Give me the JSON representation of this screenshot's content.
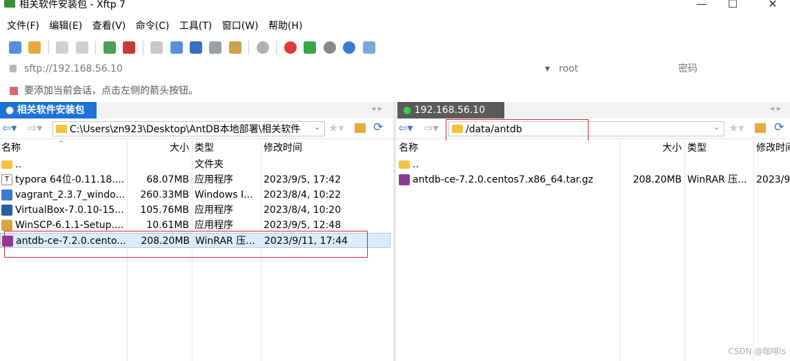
{
  "window": {
    "title": "相关软件安装包 - Xftp 7",
    "minimize": "—",
    "maximize": "☐",
    "close": "✕"
  },
  "menu": [
    "文件(F)",
    "编辑(E)",
    "查看(V)",
    "命令(C)",
    "工具(T)",
    "窗口(W)",
    "帮助(H)"
  ],
  "address": {
    "host": "sftp://192.168.56.10",
    "user": "root",
    "password": "密码"
  },
  "hint": "要添加当前会话，点击左侧的箭头按钮。",
  "left": {
    "tab": "相关软件安装包",
    "path": "C:\\Users\\zn923\\Desktop\\AntDB本地部署\\相关软件",
    "columns": {
      "name": "名称",
      "size": "大小",
      "type": "类型",
      "modified": "修改时间"
    },
    "rows": [
      {
        "name": "..",
        "size": "",
        "type": "文件夹",
        "modified": "",
        "icon": "folder-icon",
        "color": "#f5c242"
      },
      {
        "name": "typora 64位-0.11.18....",
        "size": "68.07MB",
        "type": "应用程序",
        "modified": "2023/9/5, 17:42",
        "icon": "typora-icon",
        "color": "#555555"
      },
      {
        "name": "vagrant_2.3.7_windo...",
        "size": "260.33MB",
        "type": "Windows I...",
        "modified": "2023/8/4, 10:22",
        "icon": "installer-icon",
        "color": "#3a7bd5"
      },
      {
        "name": "VirtualBox-7.0.10-15...",
        "size": "105.76MB",
        "type": "应用程序",
        "modified": "2023/8/4, 10:20",
        "icon": "virtualbox-icon",
        "color": "#2a5ea8"
      },
      {
        "name": "WinSCP-6.1.1-Setup....",
        "size": "10.61MB",
        "type": "应用程序",
        "modified": "2023/9/5, 12:48",
        "icon": "winscp-icon",
        "color": "#d8a53a"
      },
      {
        "name": "antdb-ce-7.2.0.cento...",
        "size": "208.20MB",
        "type": "WinRAR 压...",
        "modified": "2023/9/11, 17:44",
        "icon": "winrar-icon",
        "color": "#8a3a9a"
      }
    ]
  },
  "right": {
    "tab": "192.168.56.10",
    "path": "/data/antdb",
    "columns": {
      "name": "名称",
      "size": "大小",
      "type": "类型",
      "modified": "修改时间"
    },
    "rows": [
      {
        "name": "..",
        "size": "",
        "type": "",
        "modified": "",
        "icon": "folder-icon",
        "color": "#f5c242"
      },
      {
        "name": "antdb-ce-7.2.0.centos7.x86_64.tar.gz",
        "size": "208.20MB",
        "type": "WinRAR 压...",
        "modified": "2023/9",
        "icon": "winrar-icon",
        "color": "#8a3a9a"
      }
    ]
  },
  "watermark": "CSDN @咖啡ls",
  "colors": {
    "tab_active": "#1e73d6",
    "selection": "#dcebfa",
    "highlight": "#d9262c"
  }
}
